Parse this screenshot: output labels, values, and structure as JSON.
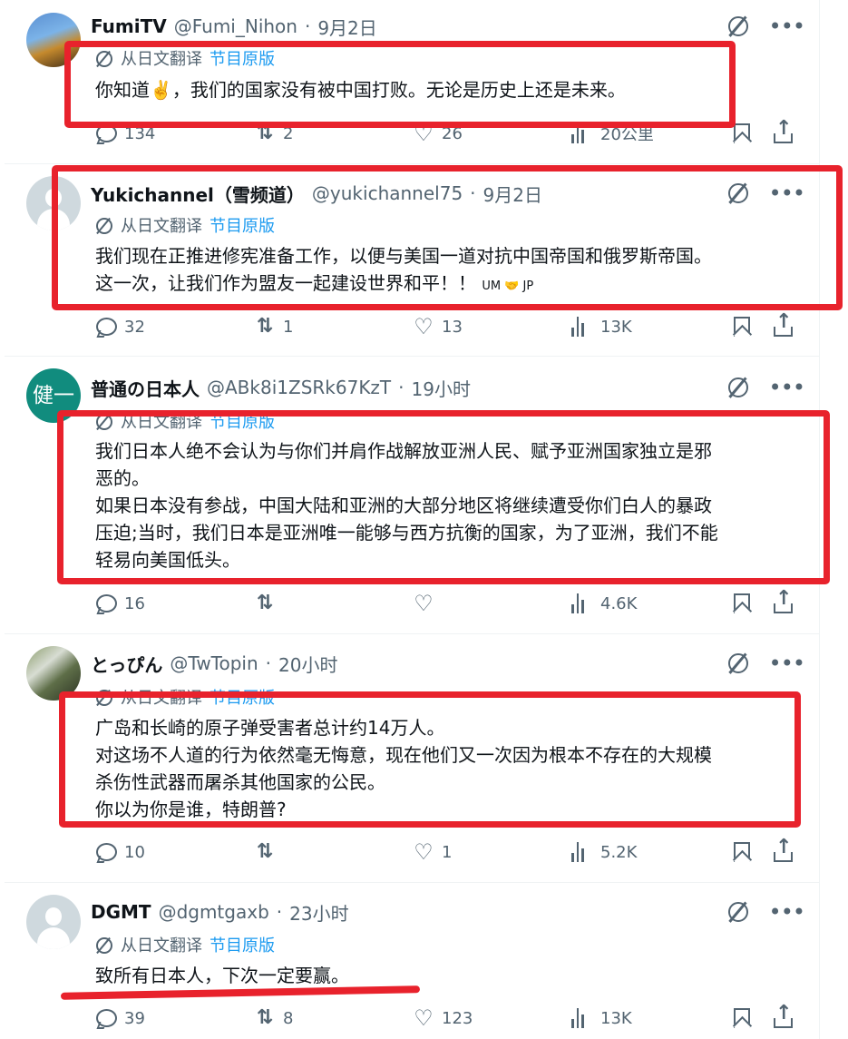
{
  "translation": {
    "from_label": "从日文翻译",
    "original_label": "节目原版"
  },
  "icons": {
    "grok": "grok-icon",
    "more": "more-icon",
    "reply": "reply-icon",
    "retweet": "retweet-icon",
    "like": "heart-icon",
    "views": "views-icon",
    "bookmark": "bookmark-icon",
    "share": "share-icon"
  },
  "colors": {
    "annotation_red": "#e8222c",
    "link_blue": "#1d9bf0",
    "muted_gray": "#536471"
  },
  "tweets": [
    {
      "name": "FumiTV",
      "handle": "@Fumi_Nihon",
      "time": "9月2日",
      "lines": [
        "你知道✌️，我们的国家没有被中国打败。无论是历史上还是未来。"
      ],
      "replies": "134",
      "retweets": "2",
      "likes": "26",
      "views": "20公里"
    },
    {
      "name": "Yukichannel（雪频道）",
      "handle": "@yukichannel75",
      "time": "9月2日",
      "lines": [
        "我们现在正推进修宪准备工作，以便与美国一道对抗中国帝国和俄罗斯帝国。",
        "这一次，让我们作为盟友一起建设世界和平！！"
      ],
      "flags": "UM 🤝 JP",
      "replies": "32",
      "retweets": "1",
      "likes": "13",
      "views": "13K"
    },
    {
      "avatar_text": "健一",
      "name": "普通の日本人",
      "handle": "@ABk8i1ZSRk67KzT",
      "time": "19小时",
      "lines": [
        "我们日本人绝不会认为与你们并肩作战解放亚洲人民、赋予亚洲国家独立是邪",
        "恶的。",
        "如果日本没有参战，中国大陆和亚洲的大部分地区将继续遭受你们白人的暴政",
        "压迫;当时，我们日本是亚洲唯一能够与西方抗衡的国家，为了亚洲，我们不能",
        "轻易向美国低头。"
      ],
      "replies": "16",
      "retweets": "",
      "likes": "",
      "views": "4.6K"
    },
    {
      "name": "とっぴん",
      "handle": "@TwTopin",
      "time": "20小时",
      "lines": [
        "广岛和长崎的原子弹受害者总计约14万人。",
        "对这场不人道的行为依然毫无悔意，现在他们又一次因为根本不存在的大规模",
        "杀伤性武器而屠杀其他国家的公民。",
        "你以为你是谁，特朗普?"
      ],
      "replies": "10",
      "retweets": "",
      "likes": "1",
      "views": "5.2K"
    },
    {
      "name": "DGMT",
      "handle": "@dgmtgaxb",
      "time": "23小时",
      "lines": [
        "致所有日本人，下次一定要赢。"
      ],
      "replies": "39",
      "retweets": "8",
      "likes": "123",
      "views": "13K"
    }
  ]
}
